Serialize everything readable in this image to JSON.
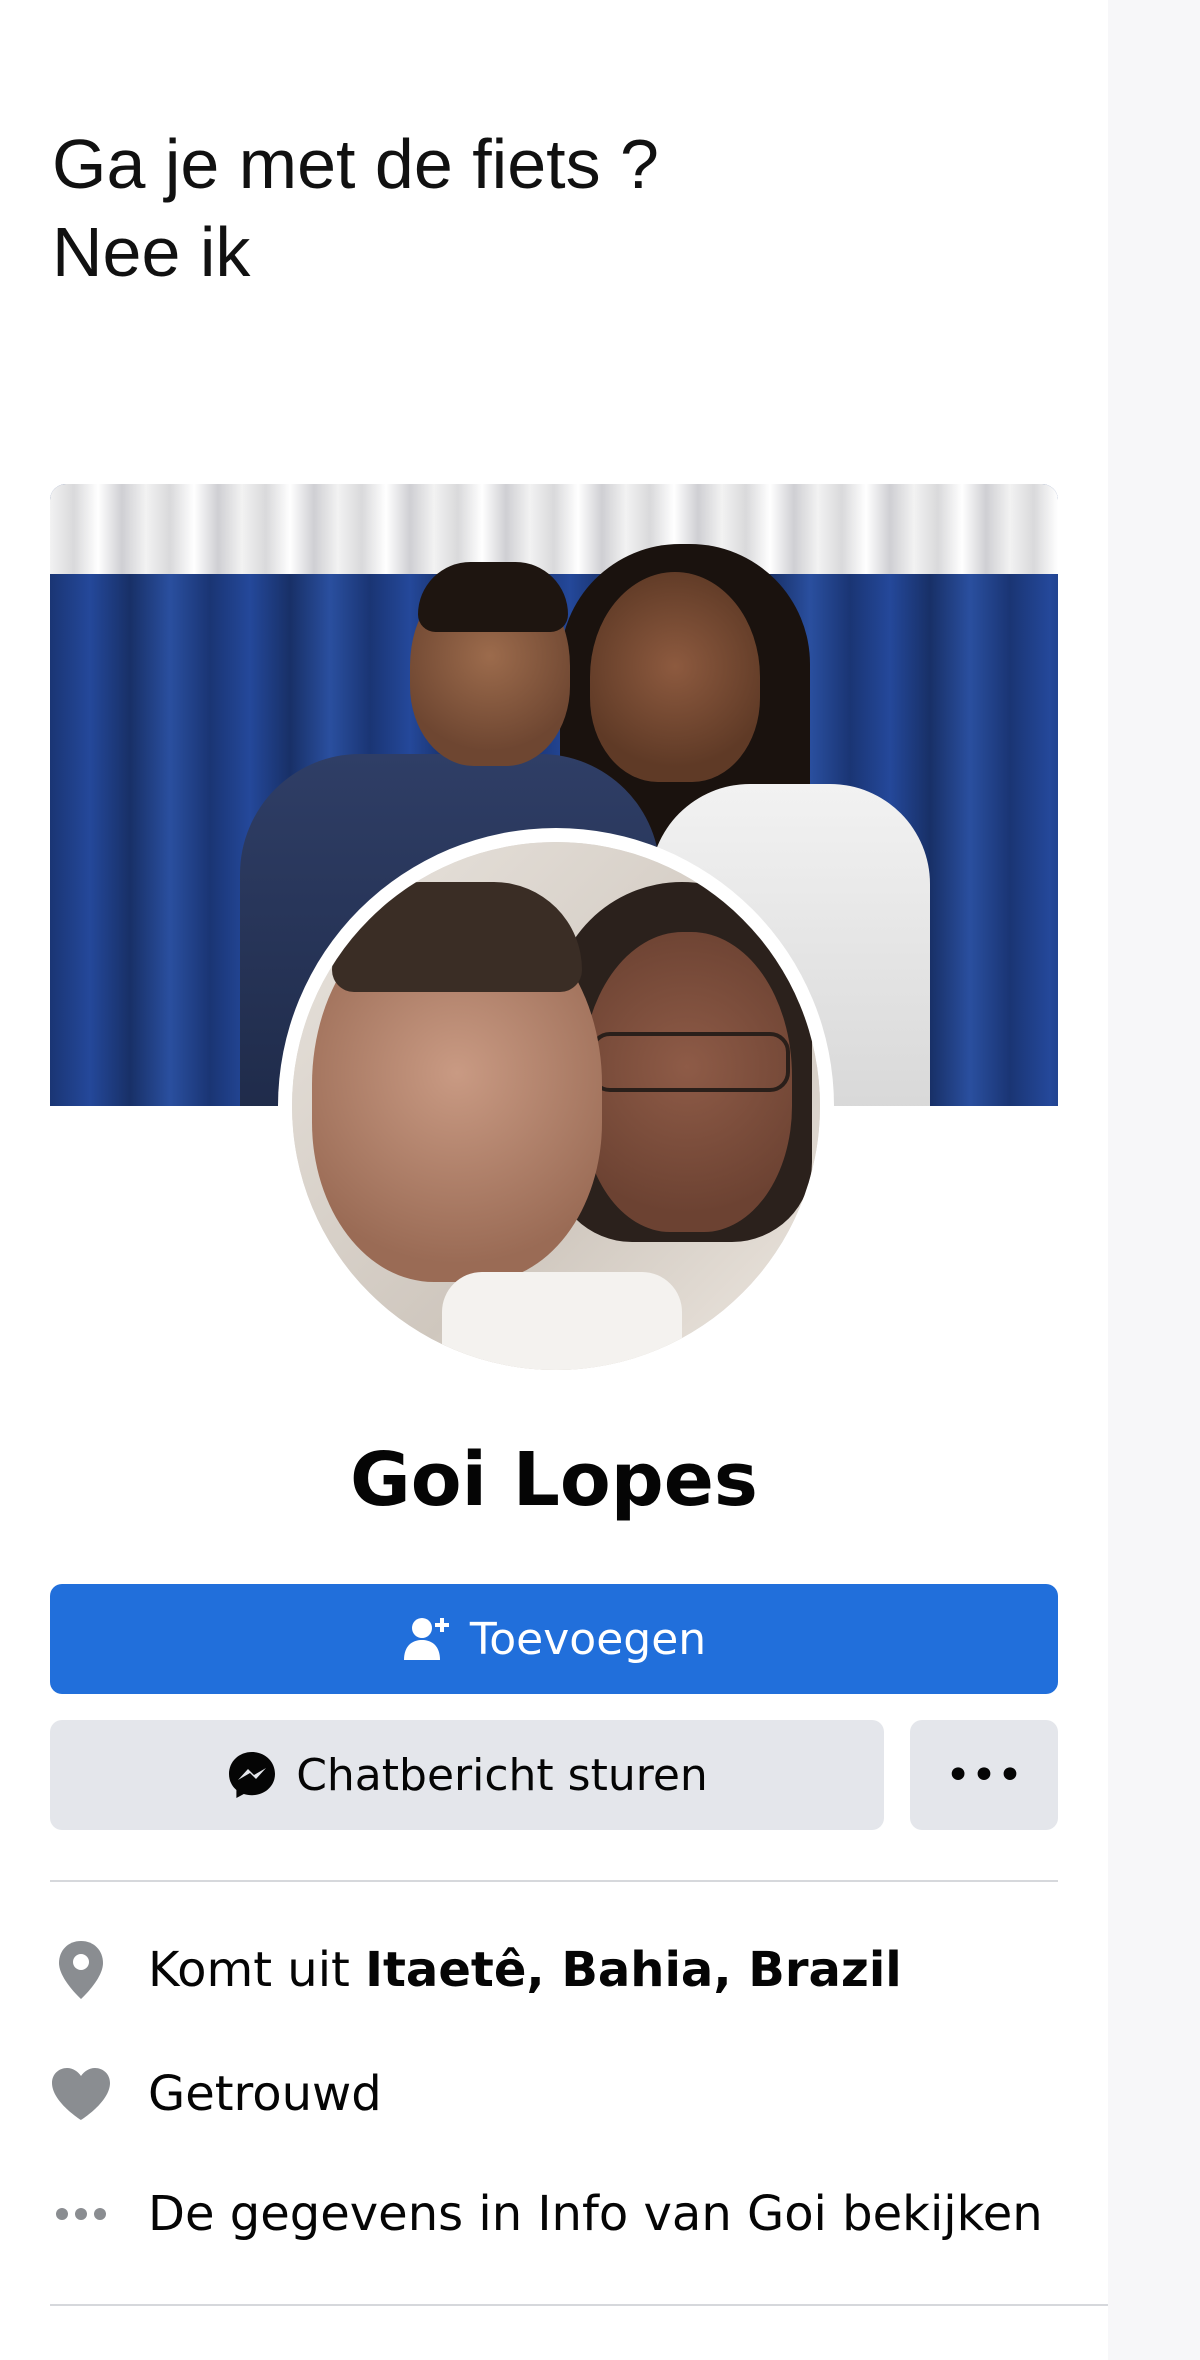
{
  "caption": {
    "line1": "Ga je met de fiets ?",
    "line2": "Nee ik"
  },
  "profile": {
    "name": "Goi Lopes"
  },
  "actions": {
    "add_label": "Toevoegen",
    "message_label": "Chatbericht sturen",
    "more_label": "•••"
  },
  "details": {
    "from_prefix": "Komt uit ",
    "from_place": "Itaetê, Bahia, Brazil",
    "relationship": "Getrouwd",
    "see_info": "De gegevens in Info van Goi bekijken"
  },
  "colors": {
    "primary_button": "#216fdb",
    "secondary_button": "#e4e6eb",
    "icon_gray": "#8a8d91"
  },
  "icons": {
    "add_friend": "add-friend-icon",
    "messenger": "messenger-icon",
    "location": "location-pin-icon",
    "relationship": "heart-icon",
    "more": "more-dots-icon"
  }
}
